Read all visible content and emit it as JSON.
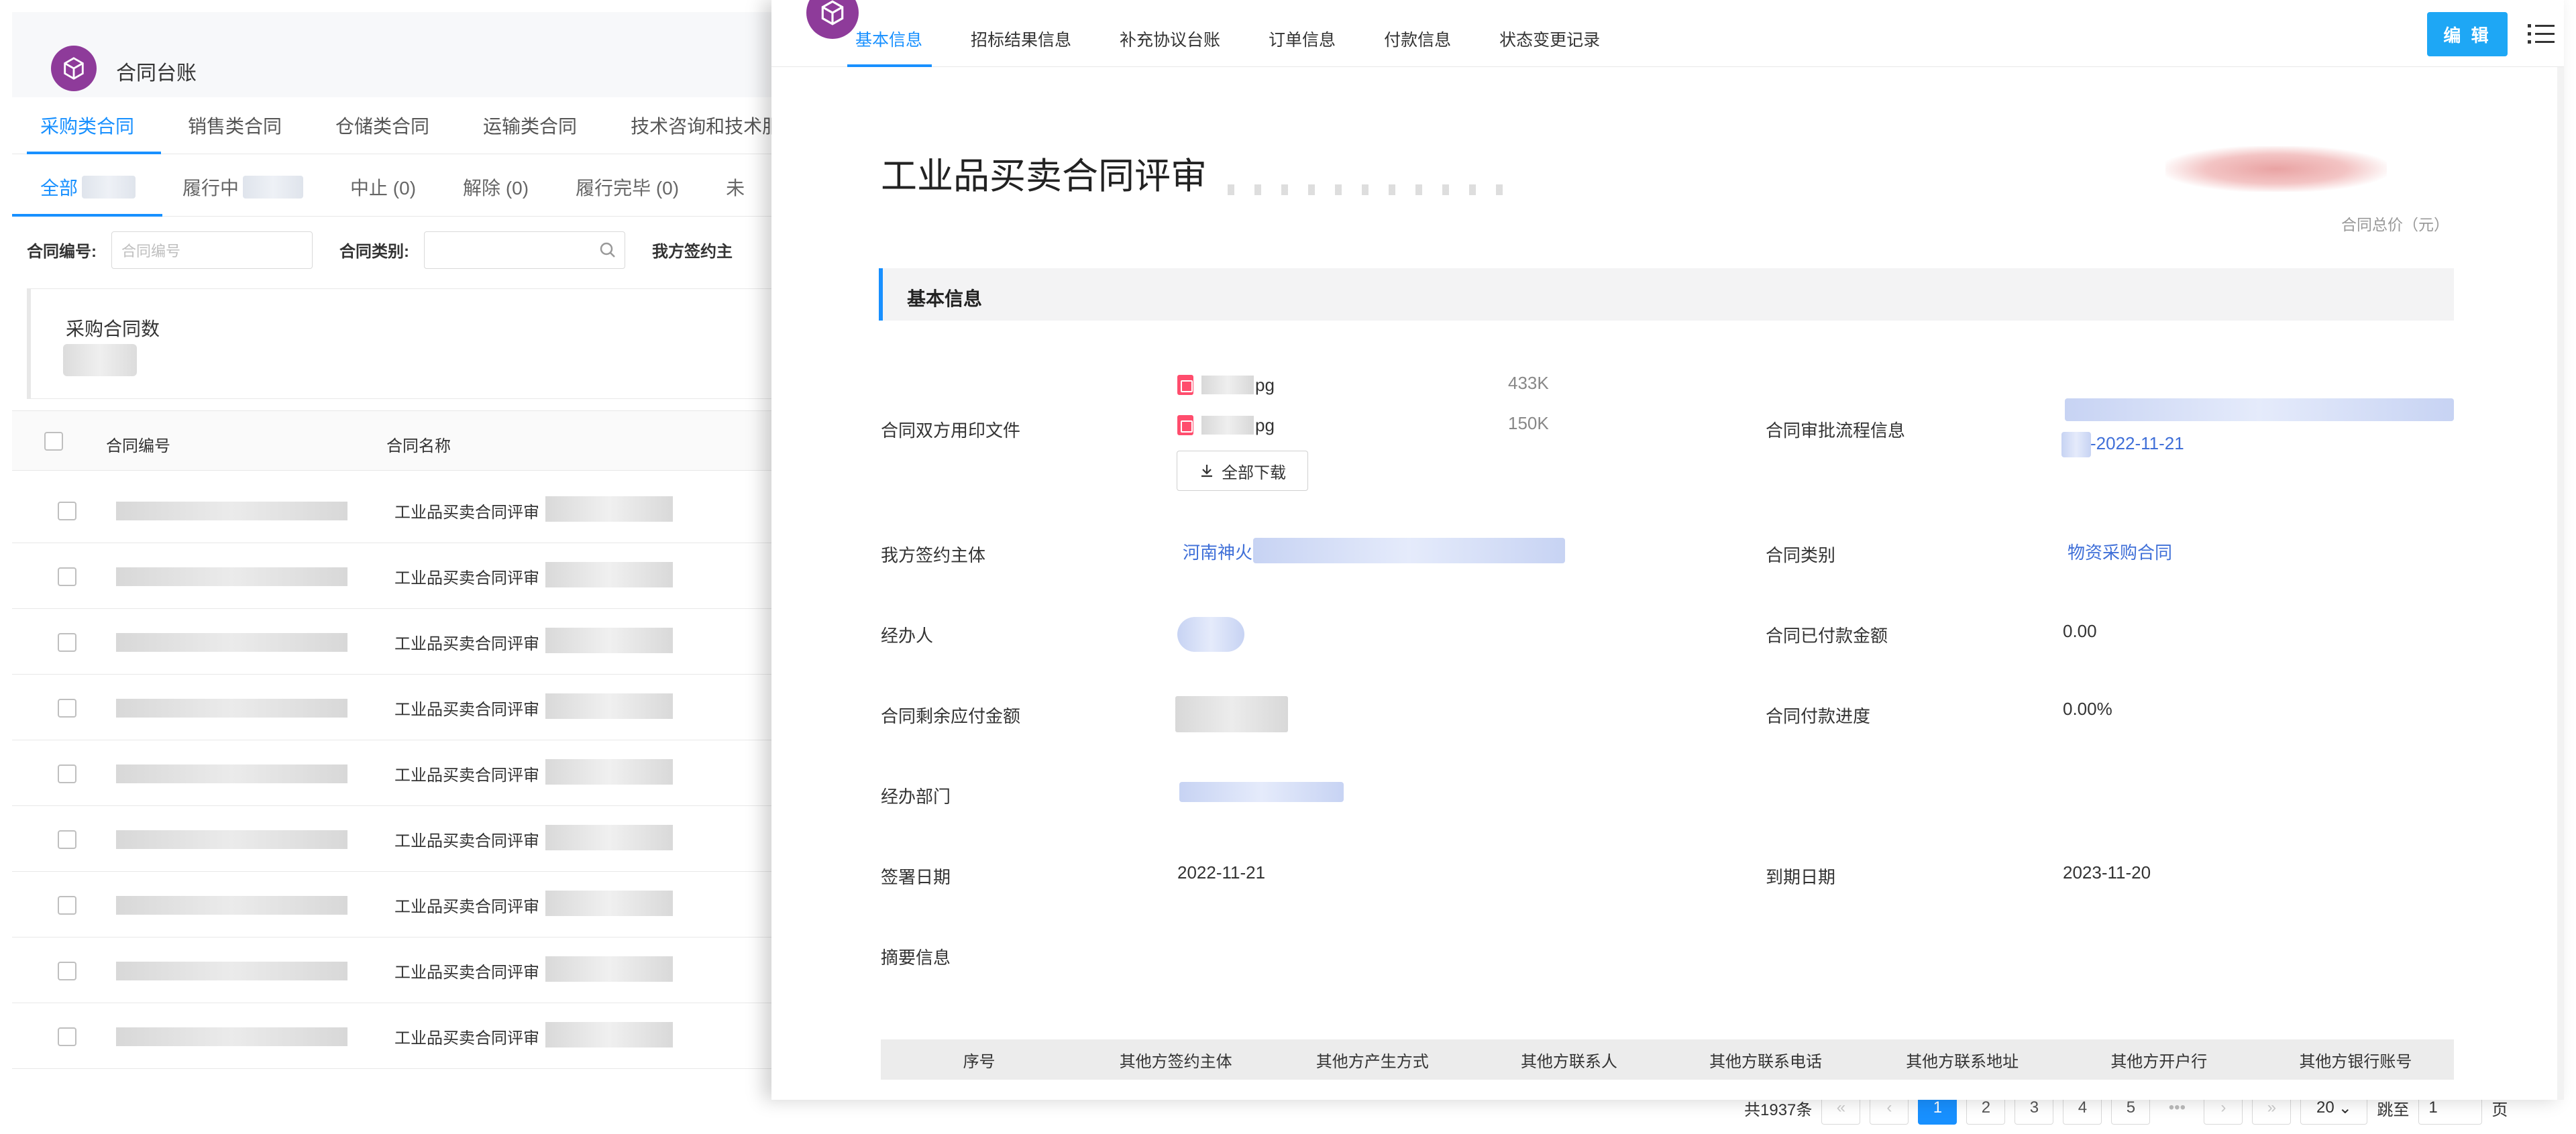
{
  "colors": {
    "accent": "#1890ff",
    "brand": "#8e3b9a",
    "edit_button": "#1ea7f5",
    "file_icon": "#ff4d6d"
  },
  "background_page": {
    "app_title": "合同台账",
    "contract_type_tabs": [
      {
        "label": "采购类合同",
        "active": true
      },
      {
        "label": "销售类合同",
        "active": false
      },
      {
        "label": "仓储类合同",
        "active": false
      },
      {
        "label": "运输类合同",
        "active": false
      },
      {
        "label": "技术咨询和技术服",
        "active": false
      }
    ],
    "status_tabs": [
      {
        "label": "全部",
        "active": true
      },
      {
        "label": "履行中",
        "active": false
      },
      {
        "label": "中止 (0)",
        "active": false
      },
      {
        "label": "解除 (0)",
        "active": false
      },
      {
        "label": "履行完毕 (0)",
        "active": false
      },
      {
        "label": "未",
        "active": false
      }
    ],
    "filters": {
      "contract_no_label": "合同编号:",
      "contract_no_placeholder": "合同编号",
      "contract_type_label": "合同类别:",
      "signing_party_label": "我方签约主"
    },
    "stats": {
      "label": "采购合同数"
    },
    "table": {
      "headers": {
        "code": "合同编号",
        "name": "合同名称"
      },
      "rows": [
        {
          "name": "工业品买卖合同评审"
        },
        {
          "name": "工业品买卖合同评审"
        },
        {
          "name": "工业品买卖合同评审"
        },
        {
          "name": "工业品买卖合同评审"
        },
        {
          "name": "工业品买卖合同评审"
        },
        {
          "name": "工业品买卖合同评审"
        },
        {
          "name": "工业品买卖合同评审"
        },
        {
          "name": "工业品买卖合同评审"
        },
        {
          "name": "工业品买卖合同评审"
        }
      ]
    },
    "pagination": {
      "total": "共1937条",
      "pages": [
        "1",
        "2",
        "3",
        "4",
        "5"
      ],
      "current": "1",
      "ellipsis": "•••",
      "page_size": "20",
      "jump_label": "跳至",
      "jump_value": "1",
      "page_suffix": "页"
    }
  },
  "drawer": {
    "tabs": [
      {
        "label": "基本信息",
        "active": true
      },
      {
        "label": "招标结果信息",
        "active": false
      },
      {
        "label": "补充协议台账",
        "active": false
      },
      {
        "label": "订单信息",
        "active": false
      },
      {
        "label": "付款信息",
        "active": false
      },
      {
        "label": "状态变更记录",
        "active": false
      }
    ],
    "edit_label": "编 辑",
    "title": "工业品买卖合同评审",
    "price_label": "合同总价（元）",
    "section_title": "基本信息",
    "fields": {
      "seal_files_label": "合同双方用印文件",
      "files": [
        {
          "ext": "pg",
          "size": "433K"
        },
        {
          "ext": "pg",
          "size": "150K"
        }
      ],
      "download_all": "全部下载",
      "approval_label": "合同审批流程信息",
      "approval_date": "-2022-11-21",
      "our_party_label": "我方签约主体",
      "our_party_value": "河南神火",
      "category_label": "合同类别",
      "category_value": "物资采购合同",
      "handler_label": "经办人",
      "paid_label": "合同已付款金额",
      "paid_value": "0.00",
      "remaining_label": "合同剩余应付金额",
      "progress_label": "合同付款进度",
      "progress_value": "0.00%",
      "dept_label": "经办部门",
      "sign_date_label": "签署日期",
      "sign_date_value": "2022-11-21",
      "expiry_label": "到期日期",
      "expiry_value": "2023-11-20",
      "summary_label": "摘要信息"
    },
    "subtable_headers": [
      "序号",
      "其他方签约主体",
      "其他方产生方式",
      "其他方联系人",
      "其他方联系电话",
      "其他方联系地址",
      "其他方开户行",
      "其他方银行账号"
    ]
  }
}
